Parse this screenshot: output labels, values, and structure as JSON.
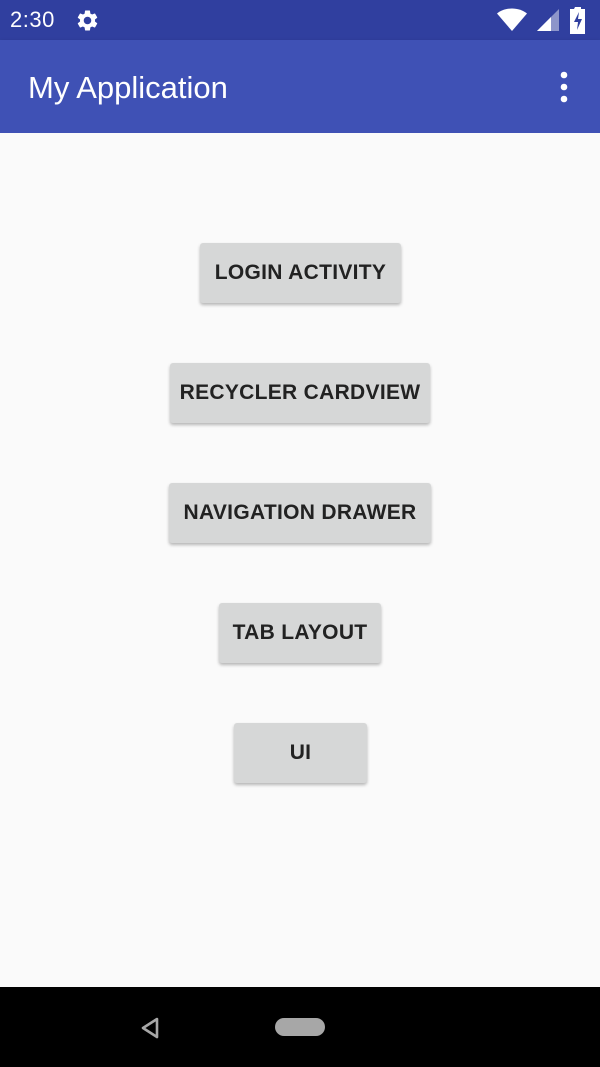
{
  "status_bar": {
    "time": "2:30",
    "icons": [
      "gear-icon",
      "wifi-icon",
      "cellular-signal-icon",
      "battery-charging-icon"
    ],
    "background_color": "#303f9f"
  },
  "app_bar": {
    "title": "My Application",
    "menu_icon": "more-vert-icon",
    "background_color": "#3f51b5"
  },
  "main": {
    "buttons": [
      {
        "label": "LOGIN ACTIVITY"
      },
      {
        "label": "RECYCLER CARDVIEW"
      },
      {
        "label": "NAVIGATION DRAWER"
      },
      {
        "label": "TAB LAYOUT"
      },
      {
        "label": "UI"
      }
    ],
    "button_color": "#d6d7d7"
  },
  "nav_bar": {
    "icons": [
      "back-icon",
      "home-pill-icon"
    ],
    "background_color": "#000000"
  }
}
